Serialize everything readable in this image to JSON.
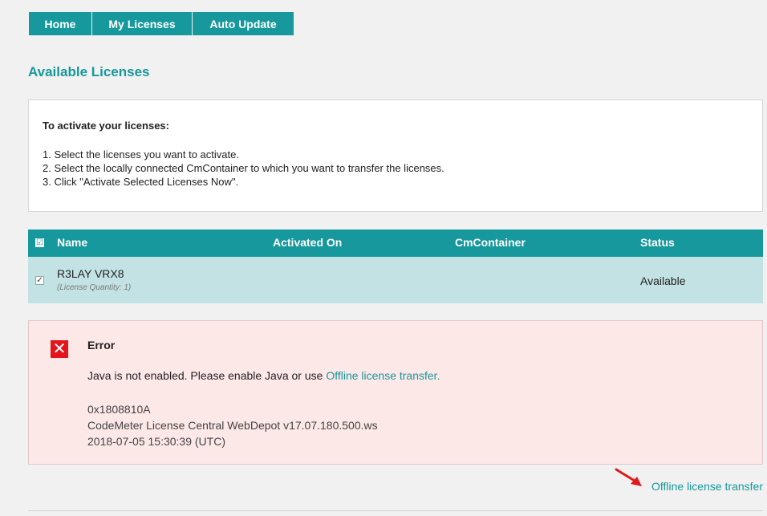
{
  "nav": {
    "tabs": [
      "Home",
      "My Licenses",
      "Auto Update"
    ]
  },
  "page": {
    "title": "Available Licenses"
  },
  "instructions": {
    "heading": "To activate your licenses:",
    "steps": [
      "1. Select the licenses you want to activate.",
      "2. Select the locally connected CmContainer to which you want to transfer the licenses.",
      "3. Click \"Activate Selected Licenses Now\"."
    ]
  },
  "table": {
    "header_checked": "☑",
    "columns": [
      "Name",
      "Activated On",
      "CmContainer",
      "Status"
    ],
    "rows": [
      {
        "checked": "✓",
        "name": "R3LAY VRX8",
        "quantity": "(License Quantity: 1)",
        "activated_on": "",
        "cmcontainer": "",
        "status": "Available"
      }
    ]
  },
  "error": {
    "icon_glyph": "✕",
    "title": "Error",
    "message_prefix": "Java is not enabled. Please enable Java or use ",
    "message_link": "Offline license transfer.",
    "code": "0x1808810A",
    "version": "CodeMeter License Central WebDepot v17.07.180.500.ws",
    "timestamp": "2018-07-05 15:30:39 (UTC)"
  },
  "footer": {
    "link": "Offline license transfer"
  },
  "colors": {
    "accent": "#16989c",
    "row_bg": "#c3e2e3",
    "error_bg": "#fde8e8",
    "error_icon": "#e4161b",
    "arrow": "#e0191b"
  }
}
